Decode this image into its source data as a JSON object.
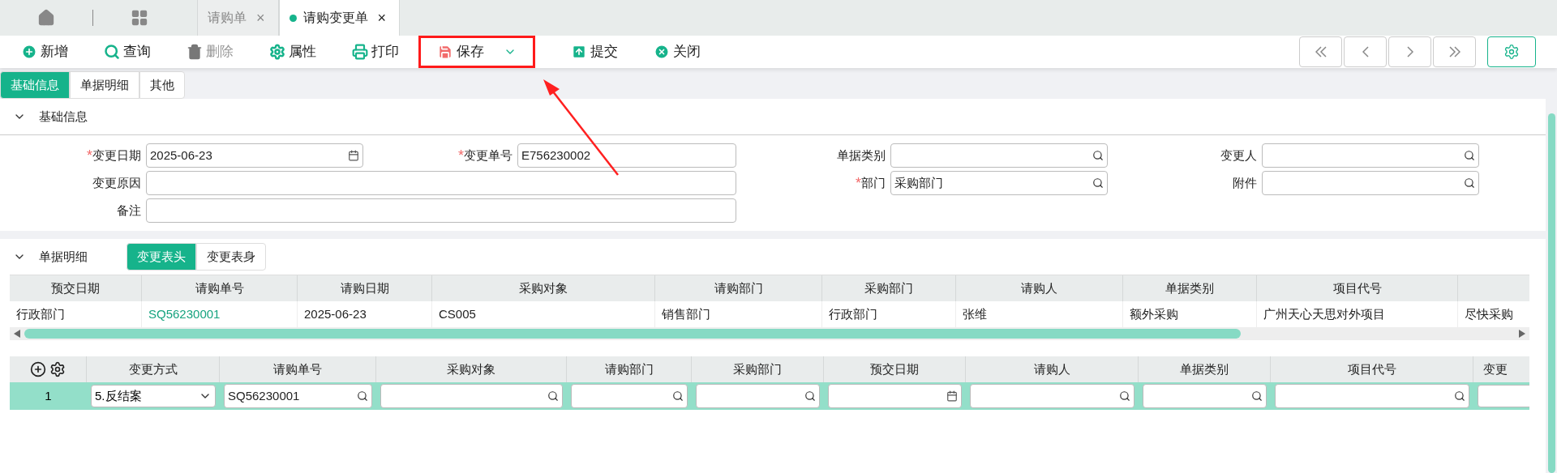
{
  "doc_tabs": [
    {
      "label": "请购单",
      "selected": false,
      "close": "×"
    },
    {
      "label": "请购变更单",
      "selected": true,
      "close": "×"
    }
  ],
  "toolbar": [
    {
      "kind": "add",
      "label": "新增",
      "disabled": false,
      "highlighted": false
    },
    {
      "kind": "search",
      "label": "查询",
      "disabled": false,
      "highlighted": false
    },
    {
      "kind": "delete",
      "label": "删除",
      "disabled": true,
      "highlighted": false
    },
    {
      "kind": "props",
      "label": "属性",
      "disabled": false,
      "highlighted": false
    },
    {
      "kind": "print",
      "label": "打印",
      "disabled": false,
      "highlighted": false
    },
    {
      "kind": "save",
      "label": "保存",
      "disabled": false,
      "highlighted": true
    },
    {
      "kind": "submit",
      "label": "提交",
      "disabled": false,
      "highlighted": false
    },
    {
      "kind": "close",
      "label": "关闭",
      "disabled": false,
      "highlighted": false
    }
  ],
  "section_tabs": [
    {
      "label": "基础信息",
      "selected": true
    },
    {
      "label": "单据明细",
      "selected": false
    },
    {
      "label": "其他",
      "selected": false
    }
  ],
  "basic_section": {
    "title": "基础信息",
    "expanded": true,
    "left_rows": [
      [
        {
          "label": "变更日期",
          "required_mark": "*",
          "kind": "date",
          "value": "2025-06-23"
        },
        {
          "label": "变更单号",
          "required_mark": "*",
          "kind": "text",
          "value": "E756230002"
        }
      ],
      [
        {
          "label": "变更原因",
          "kind": "wide"
        }
      ],
      [
        {
          "label": "备注",
          "kind": "wide"
        }
      ]
    ],
    "right_rows": [
      [
        {
          "label": "单据类别",
          "kind": "lookup"
        },
        {
          "label": "变更人",
          "kind": "lookup"
        }
      ],
      [
        {
          "label": "部门",
          "required_mark": "*",
          "kind": "lookup",
          "value": "采购部门"
        },
        {
          "label": "附件",
          "kind": "lookup"
        }
      ]
    ]
  },
  "detail_section": {
    "title": "单据明细",
    "expanded": true,
    "tabs": [
      {
        "label": "变更表头",
        "selected": true
      },
      {
        "label": "变更表身",
        "selected": false
      }
    ]
  },
  "header_table": {
    "columns": [
      "预交日期",
      "请购单号",
      "请购日期",
      "采购对象",
      "请购部门",
      "采购部门",
      "请购人",
      "单据类别",
      "项目代号"
    ],
    "rows": [
      [
        {
          "text": "行政部门"
        },
        {
          "text": "SQ56230001",
          "kind": "link"
        },
        {
          "text": "2025-06-23"
        },
        {
          "text": "CS005"
        },
        {
          "text": "销售部门"
        },
        {
          "text": "行政部门"
        },
        {
          "text": "张维"
        },
        {
          "text": "额外采购"
        },
        {
          "text": "广州天心天思对外项目"
        },
        {
          "text": "尽快采购"
        }
      ]
    ]
  },
  "body_table": {
    "columns": [
      "变更方式",
      "请购单号",
      "采购对象",
      "请购部门",
      "采购部门",
      "预交日期",
      "请购人",
      "单据类别",
      "项目代号",
      "变更"
    ],
    "rows": [
      {
        "index": "1",
        "selected": true,
        "cells": [
          {
            "kind": "select",
            "value": "5.反结案"
          },
          {
            "kind": "lookup",
            "value": "SQ56230001"
          },
          {
            "kind": "lookup"
          },
          {
            "kind": "lookup"
          },
          {
            "kind": "lookup"
          },
          {
            "kind": "date"
          },
          {
            "kind": "lookup"
          },
          {
            "kind": "lookup"
          },
          {
            "kind": "lookup"
          },
          {
            "kind": "cut"
          }
        ]
      }
    ]
  }
}
